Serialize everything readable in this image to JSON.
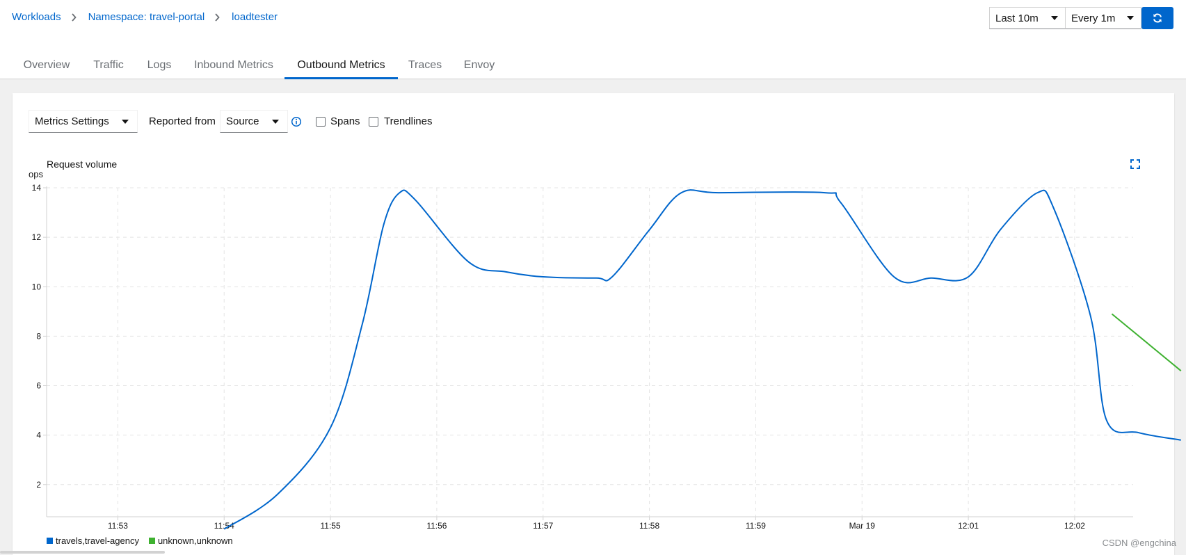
{
  "breadcrumb": {
    "items": [
      "Workloads",
      "Namespace: travel-portal",
      "loadtester"
    ]
  },
  "time_controls": {
    "duration": "Last 10m",
    "refresh_interval": "Every 1m",
    "refresh_icon": "refresh-icon"
  },
  "tabs": [
    {
      "label": "Overview",
      "active": false
    },
    {
      "label": "Traffic",
      "active": false
    },
    {
      "label": "Logs",
      "active": false
    },
    {
      "label": "Inbound Metrics",
      "active": false
    },
    {
      "label": "Outbound Metrics",
      "active": true
    },
    {
      "label": "Traces",
      "active": false
    },
    {
      "label": "Envoy",
      "active": false
    }
  ],
  "toolbar": {
    "metrics_settings": "Metrics Settings",
    "reported_from_label": "Reported from",
    "reported_from_value": "Source",
    "spans_label": "Spans",
    "trendlines_label": "Trendlines",
    "spans_checked": false,
    "trendlines_checked": false
  },
  "colors": {
    "accent": "#0066cc",
    "series_travels": "#0066cc",
    "series_unknown": "#3eb130"
  },
  "watermark": "CSDN @engchina",
  "chart_data": {
    "type": "line",
    "title": "Request volume",
    "ylabel": "ops",
    "xlabel": "",
    "ylim": [
      0.7,
      14
    ],
    "y_ticks": [
      2,
      4,
      6,
      8,
      10,
      12,
      14
    ],
    "x_ticks": [
      "11:53",
      "11:54",
      "11:55",
      "11:56",
      "11:57",
      "11:58",
      "11:59",
      "Mar 19",
      "12:01",
      "12:02"
    ],
    "x_unit": "minutes since 11:53",
    "x_range": [
      -0.67,
      9.55
    ],
    "grid": true,
    "legend_position": "bottom-left",
    "series": [
      {
        "name": "travels,travel-agency",
        "color": "#0066cc",
        "points": [
          [
            1.0,
            0.2
          ],
          [
            1.5,
            1.6
          ],
          [
            2.0,
            4.3
          ],
          [
            2.3,
            8.5
          ],
          [
            2.5,
            12.5
          ],
          [
            2.65,
            13.8
          ],
          [
            2.8,
            13.5
          ],
          [
            3.3,
            11.0
          ],
          [
            3.65,
            10.6
          ],
          [
            4.0,
            10.4
          ],
          [
            4.5,
            10.35
          ],
          [
            4.65,
            10.4
          ],
          [
            5.0,
            12.3
          ],
          [
            5.3,
            13.8
          ],
          [
            5.65,
            13.8
          ],
          [
            6.65,
            13.8
          ],
          [
            6.8,
            13.4
          ],
          [
            7.3,
            10.4
          ],
          [
            7.65,
            10.35
          ],
          [
            8.0,
            10.4
          ],
          [
            8.3,
            12.3
          ],
          [
            8.65,
            13.8
          ],
          [
            8.8,
            13.2
          ],
          [
            9.15,
            8.8
          ],
          [
            9.3,
            4.6
          ],
          [
            9.6,
            4.1
          ],
          [
            10.0,
            3.8
          ]
        ]
      },
      {
        "name": "unknown,unknown",
        "color": "#3eb130",
        "points": [
          [
            9.35,
            8.9
          ],
          [
            10.0,
            6.6
          ]
        ]
      }
    ]
  }
}
